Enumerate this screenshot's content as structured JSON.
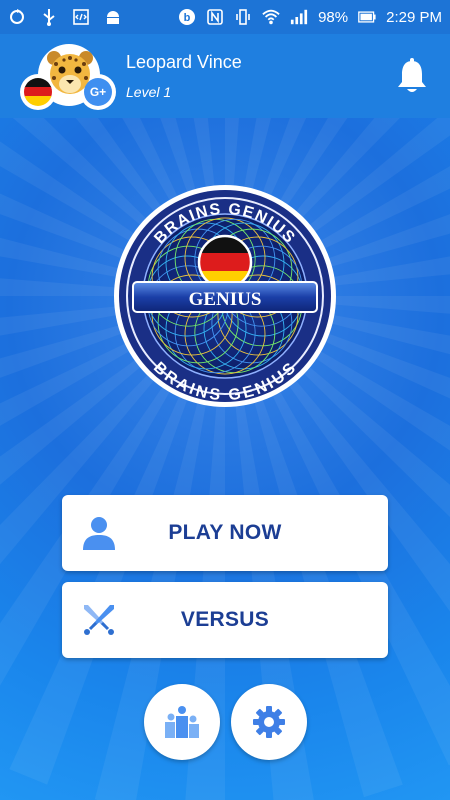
{
  "status_bar": {
    "battery": "98%",
    "time": "2:29 PM"
  },
  "header": {
    "username": "Leopard Vince",
    "level": "Level 1",
    "gplus_label": "G+"
  },
  "logo": {
    "top_text": "BRAINS GENIUS",
    "center_text": "GENIUS",
    "bottom_text": "BRAINS GENIUS"
  },
  "buttons": {
    "play_now": "PLAY NOW",
    "versus": "VERSUS"
  },
  "icons": {
    "play_now": "user-icon",
    "versus": "crossed-swords-icon",
    "leaderboard": "leaderboard-icon",
    "settings": "gear-icon",
    "notifications": "bell-icon"
  },
  "colors": {
    "accent": "#1c3e94",
    "header_bg": "#1f7fe0",
    "icon_blue": "#3f8ff0"
  }
}
